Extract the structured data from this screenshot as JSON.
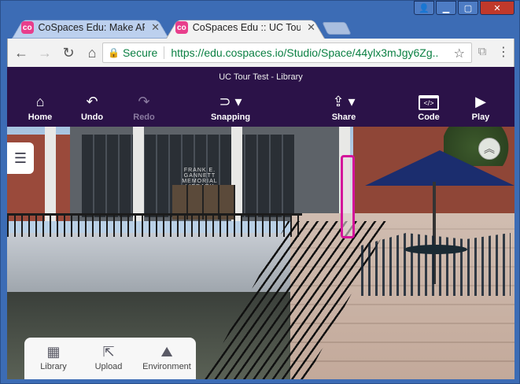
{
  "browser": {
    "tabs": [
      {
        "title": "CoSpaces Edu: Make AR &",
        "favicon": "cospaces-favicon",
        "state": "inactive"
      },
      {
        "title": "CoSpaces Edu :: UC Tour",
        "favicon": "cospaces-favicon",
        "state": "active"
      }
    ],
    "omnibox": {
      "security_label": "Secure",
      "url": "https://edu.cospaces.io/Studio/Space/44ylx3mJgy6Zg..."
    }
  },
  "header": {
    "space_title": "UC Tour Test - Library",
    "tools": {
      "home": "Home",
      "undo": "Undo",
      "redo": "Redo",
      "snapping": "Snapping",
      "share": "Share",
      "code": "Code",
      "play": "Play"
    }
  },
  "scene": {
    "sign_text": "FRANK E. GANNETT MEMORIAL LIBRARY"
  },
  "bottom_panel": {
    "library": "Library",
    "upload": "Upload",
    "environment": "Environment"
  },
  "colors": {
    "header_bg": "#2b1248",
    "selection": "#d4149a",
    "secure_green": "#0b8043"
  }
}
